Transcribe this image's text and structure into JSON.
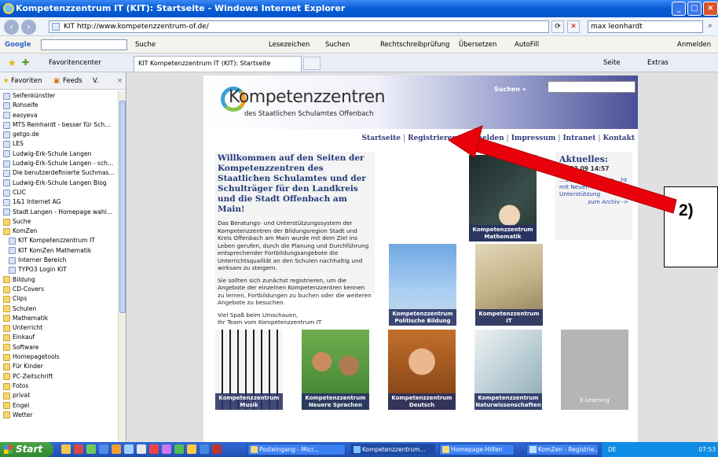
{
  "window": {
    "title": "Kompetenzzentrum IT (KIT): Startseite - Windows Internet Explorer"
  },
  "browser": {
    "address": "KIT http://www.kompetenzzentrum-of.de/",
    "search_value": "max leonhardt"
  },
  "google_toolbar": {
    "logo": "Google",
    "items": [
      "Suche",
      "Lesezeichen",
      "Suchen",
      "Rechtschreibprüfung",
      "Übersetzen",
      "AutoFill",
      "Anmelden"
    ]
  },
  "favorites_bar": {
    "label": "Favoritencenter",
    "tab_title": "KIT Kompetenzzentrum IT (KIT): Startseite",
    "right_items": [
      "Seite",
      "Extras"
    ]
  },
  "sidebar": {
    "tabs": [
      "Favoriten",
      "Feeds",
      "V."
    ],
    "items": [
      {
        "label": "Seifenkünstler",
        "type": "link"
      },
      {
        "label": "Rohseife",
        "type": "link"
      },
      {
        "label": "easyeva",
        "type": "link"
      },
      {
        "label": "MTS Reinhardt - besser für Sch...",
        "type": "link"
      },
      {
        "label": "getgo.de",
        "type": "link"
      },
      {
        "label": "LES",
        "type": "link"
      },
      {
        "label": "Ludwig-Erk-Schule Langen",
        "type": "link"
      },
      {
        "label": "Ludwig-Erk-Schule Langen - sch...",
        "type": "link"
      },
      {
        "label": "Die benutzerdefinierte Suchmas...",
        "type": "link"
      },
      {
        "label": "Ludwig-Erk-Schule Langen Blog",
        "type": "link"
      },
      {
        "label": "CLIC",
        "type": "link"
      },
      {
        "label": "1&1 Internet AG",
        "type": "link"
      },
      {
        "label": "Stadt Langen - Homepage wahl...",
        "type": "link"
      },
      {
        "label": "Suche",
        "type": "folder"
      },
      {
        "label": "KomZen",
        "type": "folder"
      },
      {
        "label": "KIT Kompetenzzentrum IT",
        "type": "sub"
      },
      {
        "label": "KIT KomZen Mathematik",
        "type": "sub"
      },
      {
        "label": "Interner Bereich",
        "type": "sub"
      },
      {
        "label": "TYPO3 Login KIT",
        "type": "sub"
      },
      {
        "label": "Bildung",
        "type": "folder"
      },
      {
        "label": "CD-Covers",
        "type": "folder"
      },
      {
        "label": "Clips",
        "type": "folder"
      },
      {
        "label": "Schulen",
        "type": "folder"
      },
      {
        "label": "Mathematik",
        "type": "folder"
      },
      {
        "label": "Unterricht",
        "type": "folder"
      },
      {
        "label": "Einkauf",
        "type": "folder"
      },
      {
        "label": "Software",
        "type": "folder"
      },
      {
        "label": "Homepagetools",
        "type": "folder"
      },
      {
        "label": "Für Kinder",
        "type": "folder"
      },
      {
        "label": "PC-Zeitschrift",
        "type": "folder"
      },
      {
        "label": "Fotos",
        "type": "folder"
      },
      {
        "label": "privat",
        "type": "folder"
      },
      {
        "label": "Engel",
        "type": "folder"
      },
      {
        "label": "Wetter",
        "type": "folder"
      }
    ]
  },
  "site": {
    "logo_title": "Kompetenzzentren",
    "logo_subtitle": "des Staatlichen Schulamtes Offenbach",
    "search_label": "Suchen »",
    "nav": [
      "Startseite",
      "Registrieren",
      "Abmelden",
      "Impressum",
      "Intranet",
      "Kontakt"
    ],
    "welcome": {
      "title": "Willkommen auf den Seiten der Kompetenzzentren des Staatlichen Schulamtes und der Schulträger für den Landkreis und die Stadt Offenbach am Main!",
      "p1": "Das Beratungs- und Unterstützungssystem der Kompetenzzentren der Bildungsregion Stadt und Kreis Offenbach am Main wurde mit dem Ziel ins Leben gerufen, durch die Planung und Durchführung entsprechender Fortbildungsangebote die Unterrichtsqualität an den Schulen nachhaltig und wirksam zu steigern.",
      "p2": "Sie sollten sich zunächst registrieren, um die Angebote der einzelnen Kompetenzzentren kennen zu lernen, Fortbildungen zu buchen oder die weiteren Angebote zu besuchen.",
      "p3_line1": "Viel Spaß beim Umschauen,",
      "p3_line2": "Ihr Team vom Kompetenzzentrum IT"
    },
    "news": {
      "title": "Aktuelles:",
      "date": "09.03.09 14:57",
      "text": "...Schule in Hessen ...ht mit Neuen M... braucht Unterstützung",
      "archive": "zum Archiv ->"
    },
    "tiles": [
      {
        "id": "mathematik",
        "caption": "Kompetenzzentrum Mathematik"
      },
      {
        "id": "politik",
        "caption": "Kompetenzzentrum Politische Bildung"
      },
      {
        "id": "it",
        "caption": "Kompetenzzentrum IT"
      },
      {
        "id": "musik",
        "caption": "Kompetenzzentrum Musik"
      },
      {
        "id": "sprachen",
        "caption": "Kompetenzzentrum Neuere Sprachen"
      },
      {
        "id": "deutsch",
        "caption": "Kompetenzzentrum Deutsch"
      },
      {
        "id": "naturwiss",
        "caption": "Kompetenzzentrum Naturwissenschaften"
      },
      {
        "id": "elearning",
        "caption": "E-Learning"
      }
    ]
  },
  "annotation": {
    "label": "2)",
    "arrow_color": "#e8000a"
  },
  "taskbar": {
    "start": "Start",
    "tasks": [
      "Posteingang - Micr...",
      "Kompetenzzentrum...",
      "Homepage-Hilfen",
      "KomZen - Registrie..."
    ],
    "tray_lang": "DE",
    "clock": "07:53"
  }
}
